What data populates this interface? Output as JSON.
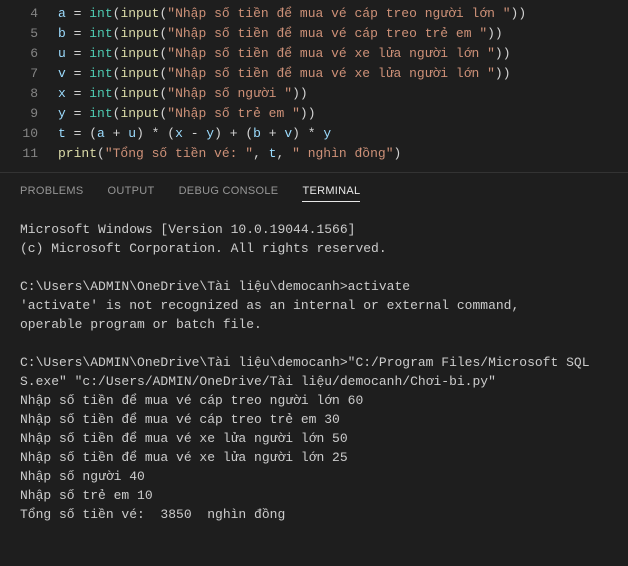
{
  "editor": {
    "lines": [
      {
        "num": "4",
        "tokens": [
          {
            "t": "a",
            "c": "tok-var"
          },
          {
            "t": " = ",
            "c": "tok-op"
          },
          {
            "t": "int",
            "c": "tok-builtin"
          },
          {
            "t": "(",
            "c": "tok-paren"
          },
          {
            "t": "input",
            "c": "tok-func"
          },
          {
            "t": "(",
            "c": "tok-paren"
          },
          {
            "t": "\"Nhập số tiền để mua vé cáp treo người lớn \"",
            "c": "tok-str"
          },
          {
            "t": "))",
            "c": "tok-paren"
          }
        ]
      },
      {
        "num": "5",
        "tokens": [
          {
            "t": "b",
            "c": "tok-var"
          },
          {
            "t": " = ",
            "c": "tok-op"
          },
          {
            "t": "int",
            "c": "tok-builtin"
          },
          {
            "t": "(",
            "c": "tok-paren"
          },
          {
            "t": "input",
            "c": "tok-func"
          },
          {
            "t": "(",
            "c": "tok-paren"
          },
          {
            "t": "\"Nhập số tiền để mua vé cáp treo trẻ em \"",
            "c": "tok-str"
          },
          {
            "t": "))",
            "c": "tok-paren"
          }
        ]
      },
      {
        "num": "6",
        "tokens": [
          {
            "t": "u",
            "c": "tok-var"
          },
          {
            "t": " = ",
            "c": "tok-op"
          },
          {
            "t": "int",
            "c": "tok-builtin"
          },
          {
            "t": "(",
            "c": "tok-paren"
          },
          {
            "t": "input",
            "c": "tok-func"
          },
          {
            "t": "(",
            "c": "tok-paren"
          },
          {
            "t": "\"Nhập số tiền để mua vé xe lửa người lớn \"",
            "c": "tok-str"
          },
          {
            "t": "))",
            "c": "tok-paren"
          }
        ]
      },
      {
        "num": "7",
        "tokens": [
          {
            "t": "v",
            "c": "tok-var"
          },
          {
            "t": " = ",
            "c": "tok-op"
          },
          {
            "t": "int",
            "c": "tok-builtin"
          },
          {
            "t": "(",
            "c": "tok-paren"
          },
          {
            "t": "input",
            "c": "tok-func"
          },
          {
            "t": "(",
            "c": "tok-paren"
          },
          {
            "t": "\"Nhập số tiền để mua vé xe lửa người lớn \"",
            "c": "tok-str"
          },
          {
            "t": "))",
            "c": "tok-paren"
          }
        ]
      },
      {
        "num": "8",
        "tokens": [
          {
            "t": "x",
            "c": "tok-var"
          },
          {
            "t": " = ",
            "c": "tok-op"
          },
          {
            "t": "int",
            "c": "tok-builtin"
          },
          {
            "t": "(",
            "c": "tok-paren"
          },
          {
            "t": "input",
            "c": "tok-func"
          },
          {
            "t": "(",
            "c": "tok-paren"
          },
          {
            "t": "\"Nhập số người \"",
            "c": "tok-str"
          },
          {
            "t": "))",
            "c": "tok-paren"
          }
        ]
      },
      {
        "num": "9",
        "tokens": [
          {
            "t": "y",
            "c": "tok-var"
          },
          {
            "t": " = ",
            "c": "tok-op"
          },
          {
            "t": "int",
            "c": "tok-builtin"
          },
          {
            "t": "(",
            "c": "tok-paren"
          },
          {
            "t": "input",
            "c": "tok-func"
          },
          {
            "t": "(",
            "c": "tok-paren"
          },
          {
            "t": "\"Nhập số trẻ em \"",
            "c": "tok-str"
          },
          {
            "t": "))",
            "c": "tok-paren"
          }
        ]
      },
      {
        "num": "10",
        "tokens": [
          {
            "t": "t",
            "c": "tok-var"
          },
          {
            "t": " = (",
            "c": "tok-op"
          },
          {
            "t": "a",
            "c": "tok-var"
          },
          {
            "t": " + ",
            "c": "tok-op"
          },
          {
            "t": "u",
            "c": "tok-var"
          },
          {
            "t": ") * (",
            "c": "tok-op"
          },
          {
            "t": "x",
            "c": "tok-var"
          },
          {
            "t": " - ",
            "c": "tok-op"
          },
          {
            "t": "y",
            "c": "tok-var"
          },
          {
            "t": ") + (",
            "c": "tok-op"
          },
          {
            "t": "b",
            "c": "tok-var"
          },
          {
            "t": " + ",
            "c": "tok-op"
          },
          {
            "t": "v",
            "c": "tok-var"
          },
          {
            "t": ") * ",
            "c": "tok-op"
          },
          {
            "t": "y",
            "c": "tok-var"
          }
        ]
      },
      {
        "num": "11",
        "tokens": [
          {
            "t": "print",
            "c": "tok-func"
          },
          {
            "t": "(",
            "c": "tok-paren"
          },
          {
            "t": "\"Tổng số tiền vé: \"",
            "c": "tok-str"
          },
          {
            "t": ", ",
            "c": "tok-op"
          },
          {
            "t": "t",
            "c": "tok-var"
          },
          {
            "t": ", ",
            "c": "tok-op"
          },
          {
            "t": "\" nghìn đồng\"",
            "c": "tok-str"
          },
          {
            "t": ")",
            "c": "tok-paren"
          }
        ]
      }
    ]
  },
  "panel": {
    "tabs": [
      {
        "label": "PROBLEMS",
        "active": false
      },
      {
        "label": "OUTPUT",
        "active": false
      },
      {
        "label": "DEBUG CONSOLE",
        "active": false
      },
      {
        "label": "TERMINAL",
        "active": true
      }
    ]
  },
  "terminal": {
    "lines": [
      "Microsoft Windows [Version 10.0.19044.1566]",
      "(c) Microsoft Corporation. All rights reserved.",
      "",
      "C:\\Users\\ADMIN\\OneDrive\\Tài liệu\\democanh>activate",
      "'activate' is not recognized as an internal or external command,",
      "operable program or batch file.",
      "",
      "C:\\Users\\ADMIN\\OneDrive\\Tài liệu\\democanh>\"C:/Program Files/Microsoft SQL S.exe\" \"c:/Users/ADMIN/OneDrive/Tài liệu/democanh/Chơi-bi.py\"",
      "Nhập số tiền để mua vé cáp treo người lớn 60",
      "Nhập số tiền để mua vé cáp treo trẻ em 30",
      "Nhập số tiền để mua vé xe lửa người lớn 50",
      "Nhập số tiền để mua vé xe lửa người lớn 25",
      "Nhập số người 40",
      "Nhập số trẻ em 10",
      "Tổng số tiền vé:  3850  nghìn đồng"
    ]
  }
}
